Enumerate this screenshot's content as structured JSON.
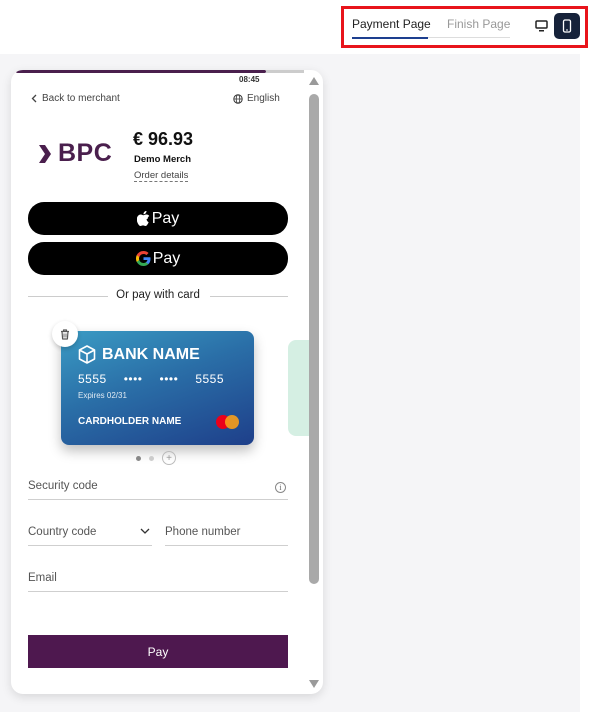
{
  "toolbar": {
    "tabs": [
      {
        "label": "Payment Page",
        "active": true
      },
      {
        "label": "Finish Page",
        "active": false
      }
    ],
    "highlight_color": "#e8141b",
    "active_device": "mobile"
  },
  "phone": {
    "clock": "08:45",
    "back_label": "Back to merchant",
    "language": "English",
    "logo_text": "BPC",
    "amount": "€ 96.93",
    "merchant": "Demo Merch",
    "order_details": "Order details",
    "apple_pay_label": "Pay",
    "google_pay_label": "Pay",
    "divider_text": "Or pay with card",
    "card": {
      "bank_name": "BANK NAME",
      "number_start": "5555",
      "number_mask1": "••••",
      "number_mask2": "••••",
      "number_end": "5555",
      "expires": "Expires 02/31",
      "holder": "CARDHOLDER NAME"
    },
    "fields": {
      "security_code": "Security code",
      "country_code": "Country code",
      "phone_number": "Phone number",
      "email": "Email"
    },
    "pay_button": "Pay",
    "brand_color": "#4e184f"
  }
}
